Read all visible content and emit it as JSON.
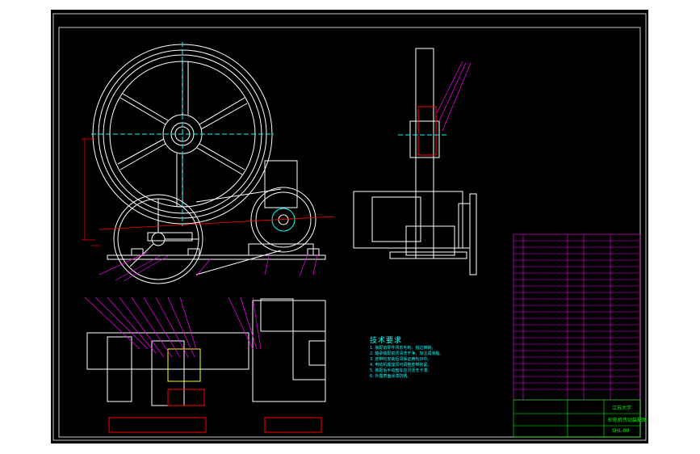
{
  "drawing": {
    "notes_title": "技术要求",
    "notes": [
      "1. 装配前零件须去毛刺、锐边倒钝。",
      "2. 轴承装配前须清洗干净，加注润滑脂。",
      "3. 皮带轮安装后须保证两轮对中。",
      "4. 电动机底座须可调整皮带张紧。",
      "5. 装配后手动盘车应灵活无卡滞。",
      "6. 外露表面涂漆防锈。"
    ],
    "title_block": {
      "school": "江苏大学",
      "drawing_title": "砂轮机传动装配图",
      "drawing_no": "SHL-00"
    },
    "bom_rows": 26
  },
  "colors": {
    "background": "#000000",
    "outline": "#ffffff",
    "dimension": "#ff0000",
    "leader": "#ff00ff",
    "hidden": "#00ffff",
    "titleblock": "#00ff00",
    "fill": "#ffff00"
  }
}
